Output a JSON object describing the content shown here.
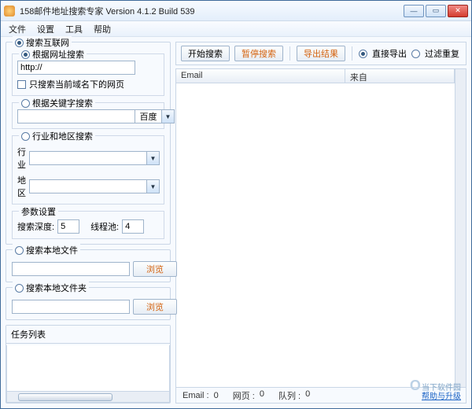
{
  "window": {
    "title": "158邮件地址搜索专家 Version 4.1.2 Build 539"
  },
  "menu": {
    "file": "文件",
    "settings": "设置",
    "tools": "工具",
    "help": "帮助"
  },
  "left": {
    "searchInternet": "搜索互联网",
    "byUrl": {
      "label": "根据网址搜索",
      "value": "http://",
      "onlyCurrentDomain": "只搜索当前域名下的网页"
    },
    "byKeyword": {
      "label": "根据关键字搜索",
      "engine": "百度"
    },
    "byIndustry": {
      "label": "行业和地区搜索",
      "industryLabel": "行业",
      "regionLabel": "地区"
    },
    "params": {
      "label": "参数设置",
      "depthLabel": "搜索深度:",
      "depthValue": "5",
      "threadLabel": "线程池:",
      "threadValue": "4"
    },
    "localFile": {
      "label": "搜索本地文件",
      "browse": "浏览"
    },
    "localFolder": {
      "label": "搜索本地文件夹",
      "browse": "浏览"
    },
    "tasks": "任务列表"
  },
  "toolbar": {
    "start": "开始搜索",
    "pause": "暂停搜索",
    "export": "导出结果",
    "directExport": "直接导出",
    "filterDup": "过滤重复"
  },
  "table": {
    "colEmail": "Email",
    "colFrom": "来自"
  },
  "status": {
    "emailLabel": "Email :",
    "emailValue": "0",
    "pageLabel": "网页 :",
    "pageValue": "0",
    "queueLabel": "队列 :",
    "queueValue": "0"
  },
  "brand": {
    "name": "当下软件园",
    "link": "帮助与升级"
  }
}
